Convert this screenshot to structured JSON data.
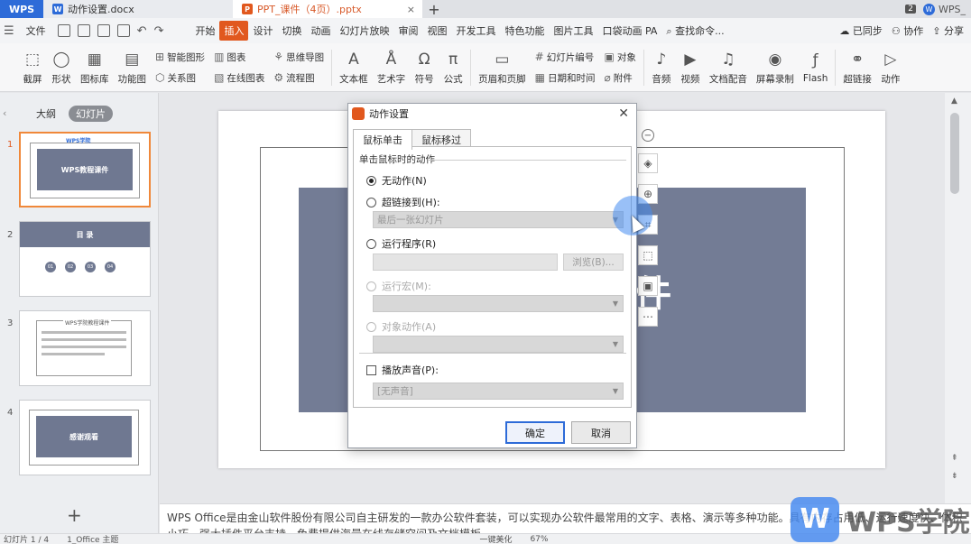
{
  "tabs": {
    "app": "WPS",
    "writer_doc": "动作设置.docx",
    "active_doc": "PPT_课件（4页）.pptx",
    "badge": "2",
    "account": "WPS_"
  },
  "menu": {
    "file": "文件",
    "items": [
      "开始",
      "插入",
      "设计",
      "切换",
      "动画",
      "幻灯片放映",
      "审阅",
      "视图",
      "开发工具",
      "特色功能",
      "图片工具",
      "口袋动画 PA"
    ],
    "search": "查找命令...",
    "sync": "已同步",
    "collab": "协作",
    "share": "分享"
  },
  "ribbon": {
    "screenshot": "截屏",
    "shape": "形状",
    "iconlib": "图标库",
    "funcmap": "功能图",
    "smartshape": "智能图形",
    "chart": "图表",
    "relation": "关系图",
    "onlinechart": "在线图表",
    "mindmap": "思维导图",
    "flowchart": "流程图",
    "textbox": "文本框",
    "arttext": "艺术字",
    "symbol": "符号",
    "formula": "公式",
    "headerfooter": "页眉和页脚",
    "slideno": "幻灯片编号",
    "datetime": "日期和时间",
    "object": "对象",
    "attach": "附件",
    "audio": "音频",
    "video": "视频",
    "dubbing": "文档配音",
    "screenrec": "屏幕录制",
    "flash": "Flash",
    "hyperlink": "超链接",
    "action": "动作"
  },
  "leftpanel": {
    "outline": "大纲",
    "slides": "幻灯片",
    "thumbs": [
      {
        "num": "1",
        "header": "WPS学院",
        "title": "WPS教程课件"
      },
      {
        "num": "2",
        "title": "目 录",
        "dots": [
          "01",
          "02",
          "03",
          "04"
        ]
      },
      {
        "num": "3",
        "title": "WPS学院教程课件"
      },
      {
        "num": "4",
        "title": "感谢观看"
      }
    ]
  },
  "slide": {
    "visible_text": "件"
  },
  "dialog": {
    "title": "动作设置",
    "tab_click": "鼠标单击",
    "tab_hover": "鼠标移过",
    "group": "单击鼠标时的动作",
    "opt_none": "无动作(N)",
    "opt_hyperlink": "超链接到(H):",
    "hyperlink_value": "最后一张幻灯片",
    "opt_program": "运行程序(R)",
    "browse": "浏览(B)...",
    "opt_macro": "运行宏(M):",
    "opt_object": "对象动作(A)",
    "play_sound": "播放声音(P):",
    "sound_value": "[无声音]",
    "ok": "确定",
    "cancel": "取消"
  },
  "notes": "WPS Office是由金山软件股份有限公司自主研发的一款办公软件套装，可以实现办公软件最常用的文字、表格、演示等多种功能。具有内存占用低、运行速度快、体积小巧、强大插件平台支持、免费提供海量在线存储空间及文档模板。",
  "status": {
    "slide_pos": "幻灯片 1 / 4",
    "theme": "1_Office 主题",
    "beautify": "一键美化",
    "zoom": "67%"
  },
  "watermark": "WPS学院"
}
